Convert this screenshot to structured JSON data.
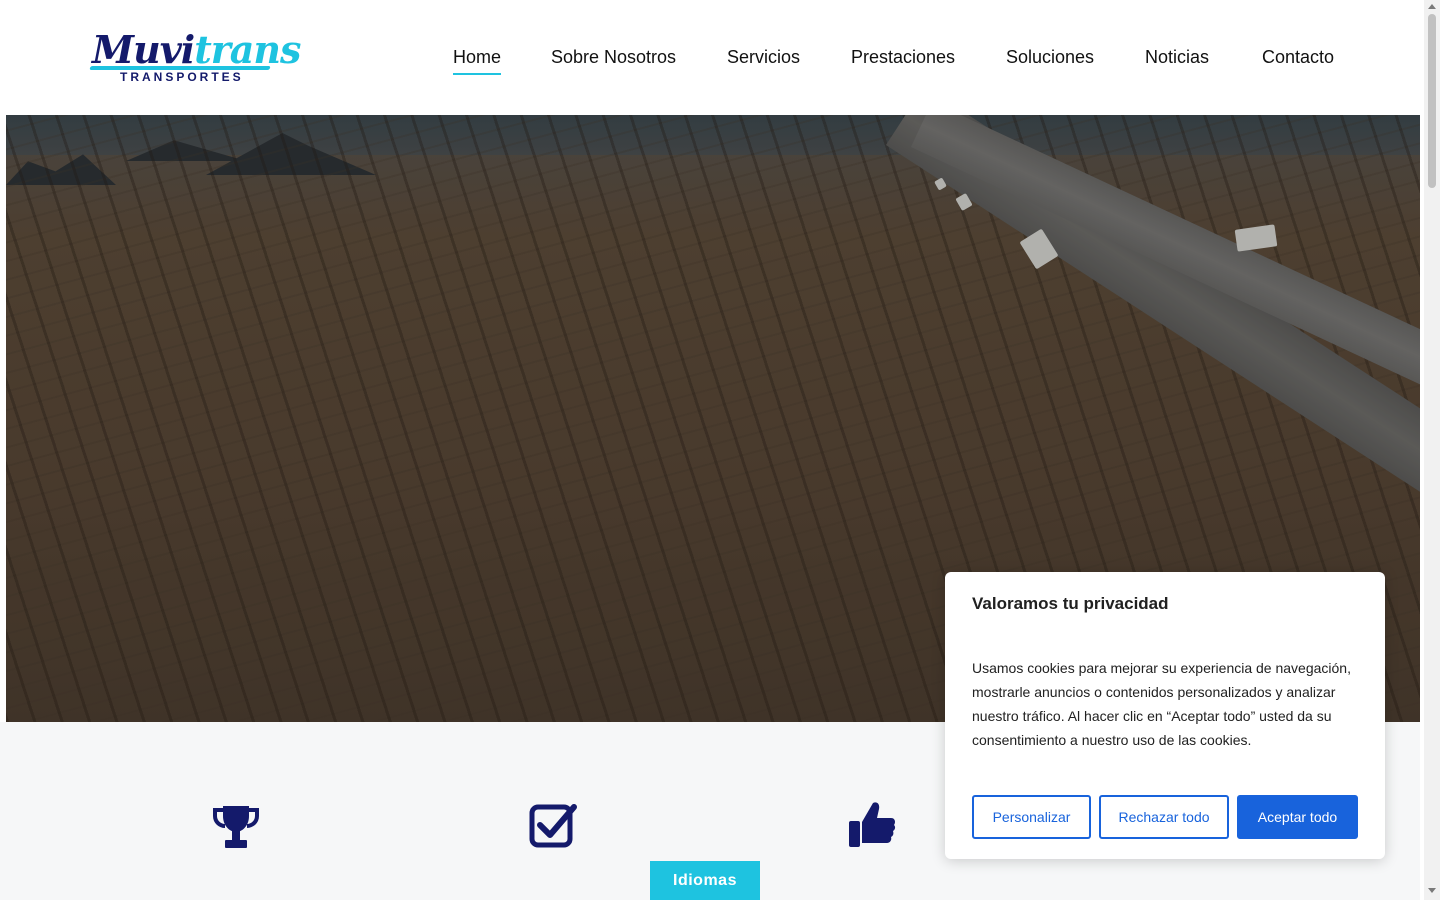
{
  "brand": {
    "logo_part1": "Muvi",
    "logo_part2": "trans",
    "logo_sub": "TRANSPORTES",
    "primary_color": "#141a6b",
    "accent_color": "#1ec3e0"
  },
  "nav": {
    "items": [
      {
        "label": "Home",
        "active": true
      },
      {
        "label": "Sobre Nosotros",
        "active": false
      },
      {
        "label": "Servicios",
        "active": false
      },
      {
        "label": "Prestaciones",
        "active": false
      },
      {
        "label": "Soluciones",
        "active": false
      },
      {
        "label": "Noticias",
        "active": false
      },
      {
        "label": "Contacto",
        "active": false
      }
    ]
  },
  "hero": {
    "image": "aerial-desert-highway-trucks"
  },
  "features": [
    {
      "icon": "trophy-icon"
    },
    {
      "icon": "checkbox-icon"
    },
    {
      "icon": "thumbs-up-icon"
    }
  ],
  "language_button": {
    "label": "Idiomas"
  },
  "cookie_banner": {
    "title": "Valoramos tu privacidad",
    "text": "Usamos cookies para mejorar su experiencia de navegación, mostrarle anuncios o contenidos personalizados y analizar nuestro tráfico. Al hacer clic en “Aceptar todo” usted da su consentimiento a nuestro uso de las cookies.",
    "buttons": {
      "customize": "Personalizar",
      "reject": "Rechazar todo",
      "accept": "Aceptar todo"
    },
    "button_color": "#1863dc"
  }
}
